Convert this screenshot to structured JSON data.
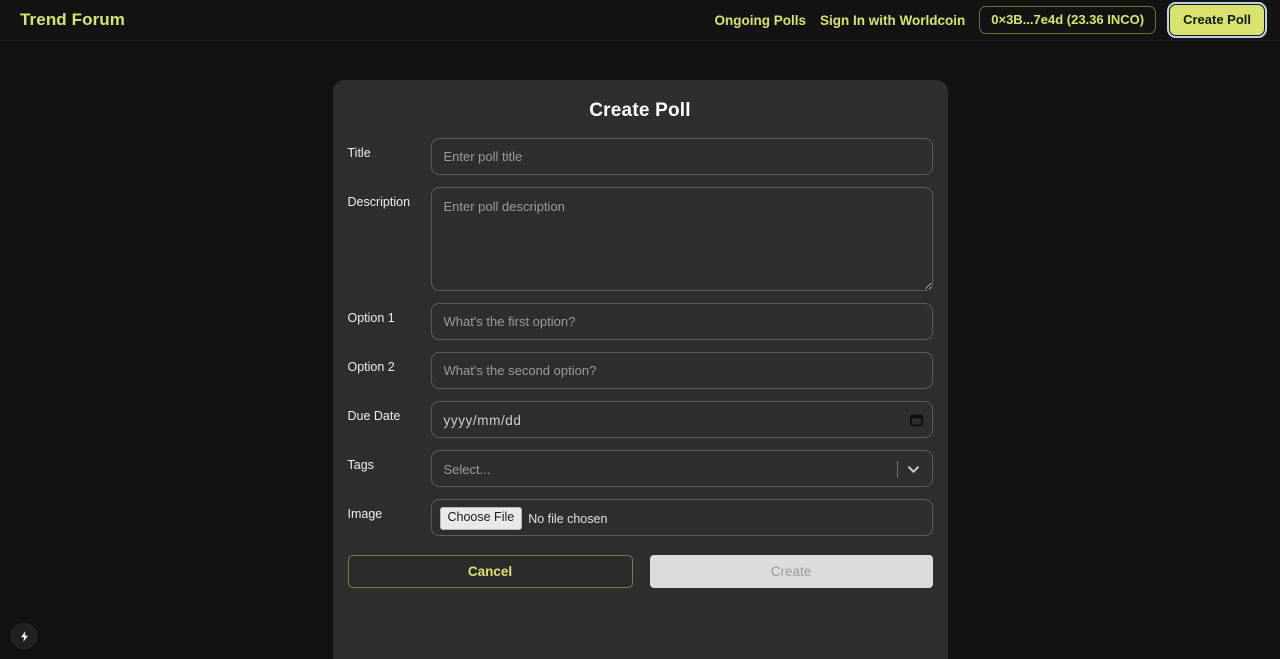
{
  "header": {
    "brand": "Trend Forum",
    "nav_links": [
      {
        "label": "Ongoing Polls",
        "name": "nav-ongoing-polls"
      },
      {
        "label": "Sign In with Worldcoin",
        "name": "nav-sign-in-worldcoin"
      }
    ],
    "wallet_badge": "0×3B...7e4d (23.36 INCO)",
    "create_poll_label": "Create Poll",
    "accent_color": "#dbe26b",
    "focus_ring_color": "#b9d6ea"
  },
  "card": {
    "title": "Create Poll",
    "fields": {
      "title": {
        "label": "Title",
        "value": "",
        "placeholder": "Enter poll title"
      },
      "description": {
        "label": "Description",
        "value": "",
        "placeholder": "Enter poll description"
      },
      "option1": {
        "label": "Option 1",
        "value": "",
        "placeholder": "What's the first option?"
      },
      "option2": {
        "label": "Option 2",
        "value": "",
        "placeholder": "What's the second option?"
      },
      "due_date": {
        "label": "Due Date",
        "value": "",
        "placeholder": "yyyy/mm/dd",
        "icon": "calendar-icon"
      },
      "tags": {
        "label": "Tags",
        "value": "",
        "placeholder": "Select...",
        "icon": "chevron-down-icon"
      },
      "image": {
        "label": "Image",
        "button_label": "Choose File",
        "status": "No file chosen"
      }
    },
    "actions": {
      "cancel_label": "Cancel",
      "create_label": "Create",
      "create_disabled": true
    }
  },
  "floating_badge": {
    "icon": "lightning-bolt-icon"
  }
}
